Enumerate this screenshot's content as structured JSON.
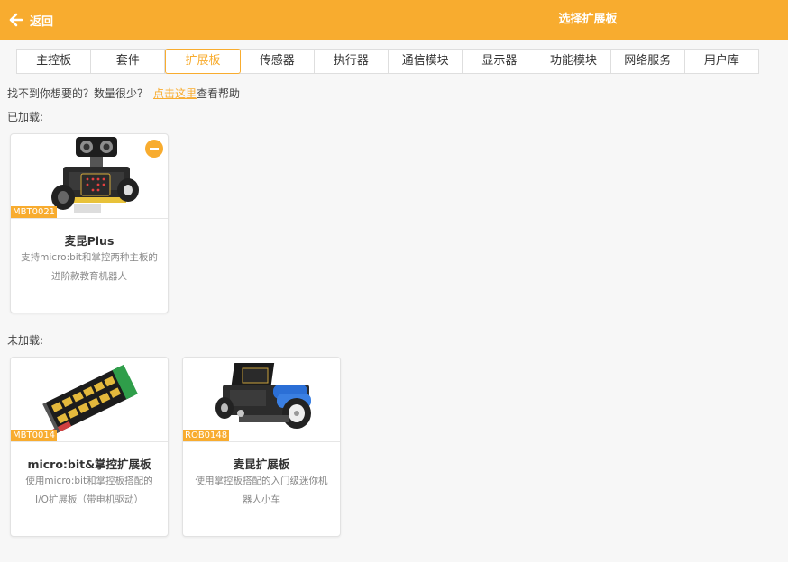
{
  "header": {
    "back_label": "返回",
    "title": "选择扩展板",
    "back_icon": "left-arrow-icon",
    "accent_color": "#f8ac2f"
  },
  "tabs": [
    {
      "label": "主控板",
      "active": false
    },
    {
      "label": "套件",
      "active": false
    },
    {
      "label": "扩展板",
      "active": true
    },
    {
      "label": "传感器",
      "active": false
    },
    {
      "label": "执行器",
      "active": false
    },
    {
      "label": "通信模块",
      "active": false
    },
    {
      "label": "显示器",
      "active": false
    },
    {
      "label": "功能模块",
      "active": false
    },
    {
      "label": "网络服务",
      "active": false
    },
    {
      "label": "用户库",
      "active": false
    }
  ],
  "help": {
    "prefix": "找不到你想要的？数量很少？",
    "link": "点击这里",
    "suffix": "查看帮助"
  },
  "loaded": {
    "label": "已加载:",
    "cards": [
      {
        "badge": "MBT0021",
        "name": "麦昆Plus",
        "desc": "支持micro:bit和掌控两种主板的进阶款教育机器人",
        "remove_icon": "minus-circle-icon"
      }
    ]
  },
  "unloaded": {
    "label": "未加载:",
    "cards": [
      {
        "badge": "MBT0014",
        "name": "micro:bit&掌控扩展板",
        "desc": "使用micro:bit和掌控板搭配的I/O扩展板（带电机驱动）"
      },
      {
        "badge": "ROB0148",
        "name": "麦昆扩展板",
        "desc": "使用掌控板搭配的入门级迷你机器人小车"
      }
    ]
  }
}
